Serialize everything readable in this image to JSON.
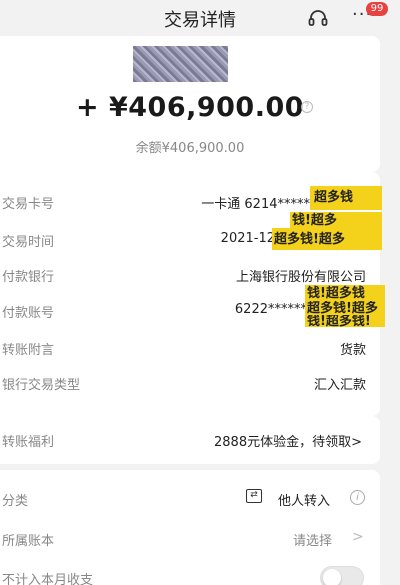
{
  "header": {
    "title": "交易详情",
    "badge_count": "99",
    "support_icon": "headset-icon",
    "more_icon": "more-icon",
    "more_glyph": "···"
  },
  "summary": {
    "amount": "+ ¥406,900.00",
    "balance": "余额¥406,900.00",
    "help_glyph": "?"
  },
  "details": [
    {
      "label": "交易卡号",
      "value": "一卡通 6214*****"
    },
    {
      "label": "交易时间",
      "value": "2021-12"
    },
    {
      "label": "付款银行",
      "value": "上海银行股份有限公司"
    },
    {
      "label": "付款账号",
      "value": "6222******"
    },
    {
      "label": "转账附言",
      "value": "货款"
    },
    {
      "label": "银行交易类型",
      "value": "汇入汇款"
    }
  ],
  "watermark": {
    "line1": "超多钱",
    "line2": "钱!超多",
    "line3": "超多钱!超多",
    "line4": "钱!超多钱",
    "line5": "超多钱!超多",
    "line6": "钱!超多钱!"
  },
  "welfare": {
    "label": "转账福利",
    "value": "2888元体验金，待领取>"
  },
  "bottom": {
    "category_label": "分类",
    "category_value": "他人转入",
    "category_glyph": "⇄",
    "info_glyph": "i",
    "ledger_label": "所属账本",
    "ledger_value": "请选择",
    "chevron": ">",
    "exclude_label": "不计入本月收支",
    "exclude_enabled": false
  },
  "colors": {
    "stamp": "#f4d21c",
    "badge": "#e64340"
  }
}
